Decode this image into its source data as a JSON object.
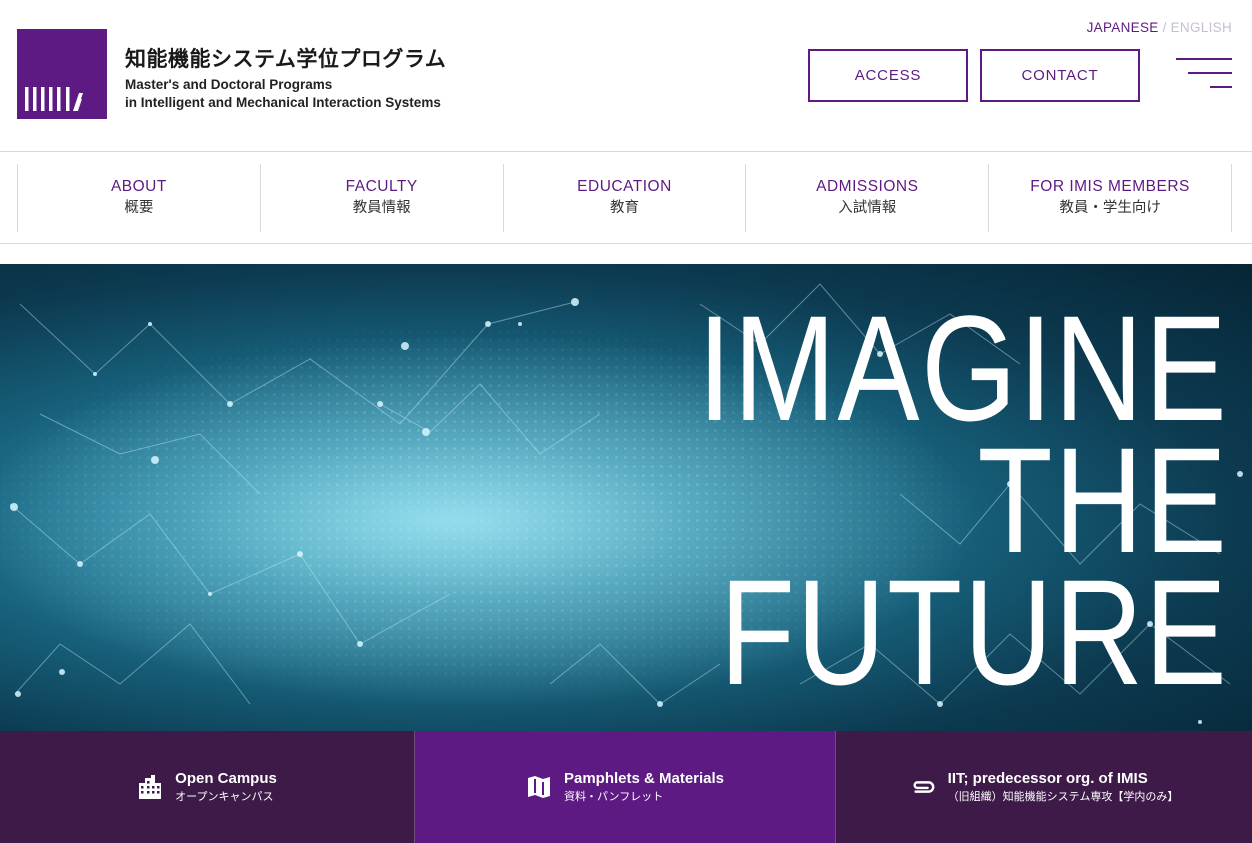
{
  "header": {
    "logo_title": "知能機能システム学位プログラム",
    "logo_sub_line1": "Master's and Doctoral Programs",
    "logo_sub_line2": "in Intelligent and Mechanical Interaction Systems",
    "lang_active": "JAPANESE",
    "lang_separator": "/",
    "lang_inactive": "ENGLISH",
    "access_label": "ACCESS",
    "contact_label": "CONTACT",
    "brand_color": "#5d1a82"
  },
  "nav": {
    "items": [
      {
        "en": "ABOUT",
        "ja": "概要"
      },
      {
        "en": "FACULTY",
        "ja": "教員情報"
      },
      {
        "en": "EDUCATION",
        "ja": "教育"
      },
      {
        "en": "ADMISSIONS",
        "ja": "入試情報"
      },
      {
        "en": "FOR IMIS MEMBERS",
        "ja": "教員・学生向け"
      }
    ]
  },
  "hero": {
    "line1": "IMAGINE",
    "line2": "THE",
    "line3": "FUTURE"
  },
  "bottom": {
    "items": [
      {
        "title": "Open Campus",
        "sub": "オープンキャンパス",
        "icon": "building-icon"
      },
      {
        "title": "Pamphlets & Materials",
        "sub": "資料・パンフレット",
        "icon": "map-icon"
      },
      {
        "title": "IIT; predecessor org. of IMIS",
        "sub": "（旧組織）知能機能システム専攻【学内のみ】",
        "icon": "paperclip-icon"
      }
    ]
  }
}
